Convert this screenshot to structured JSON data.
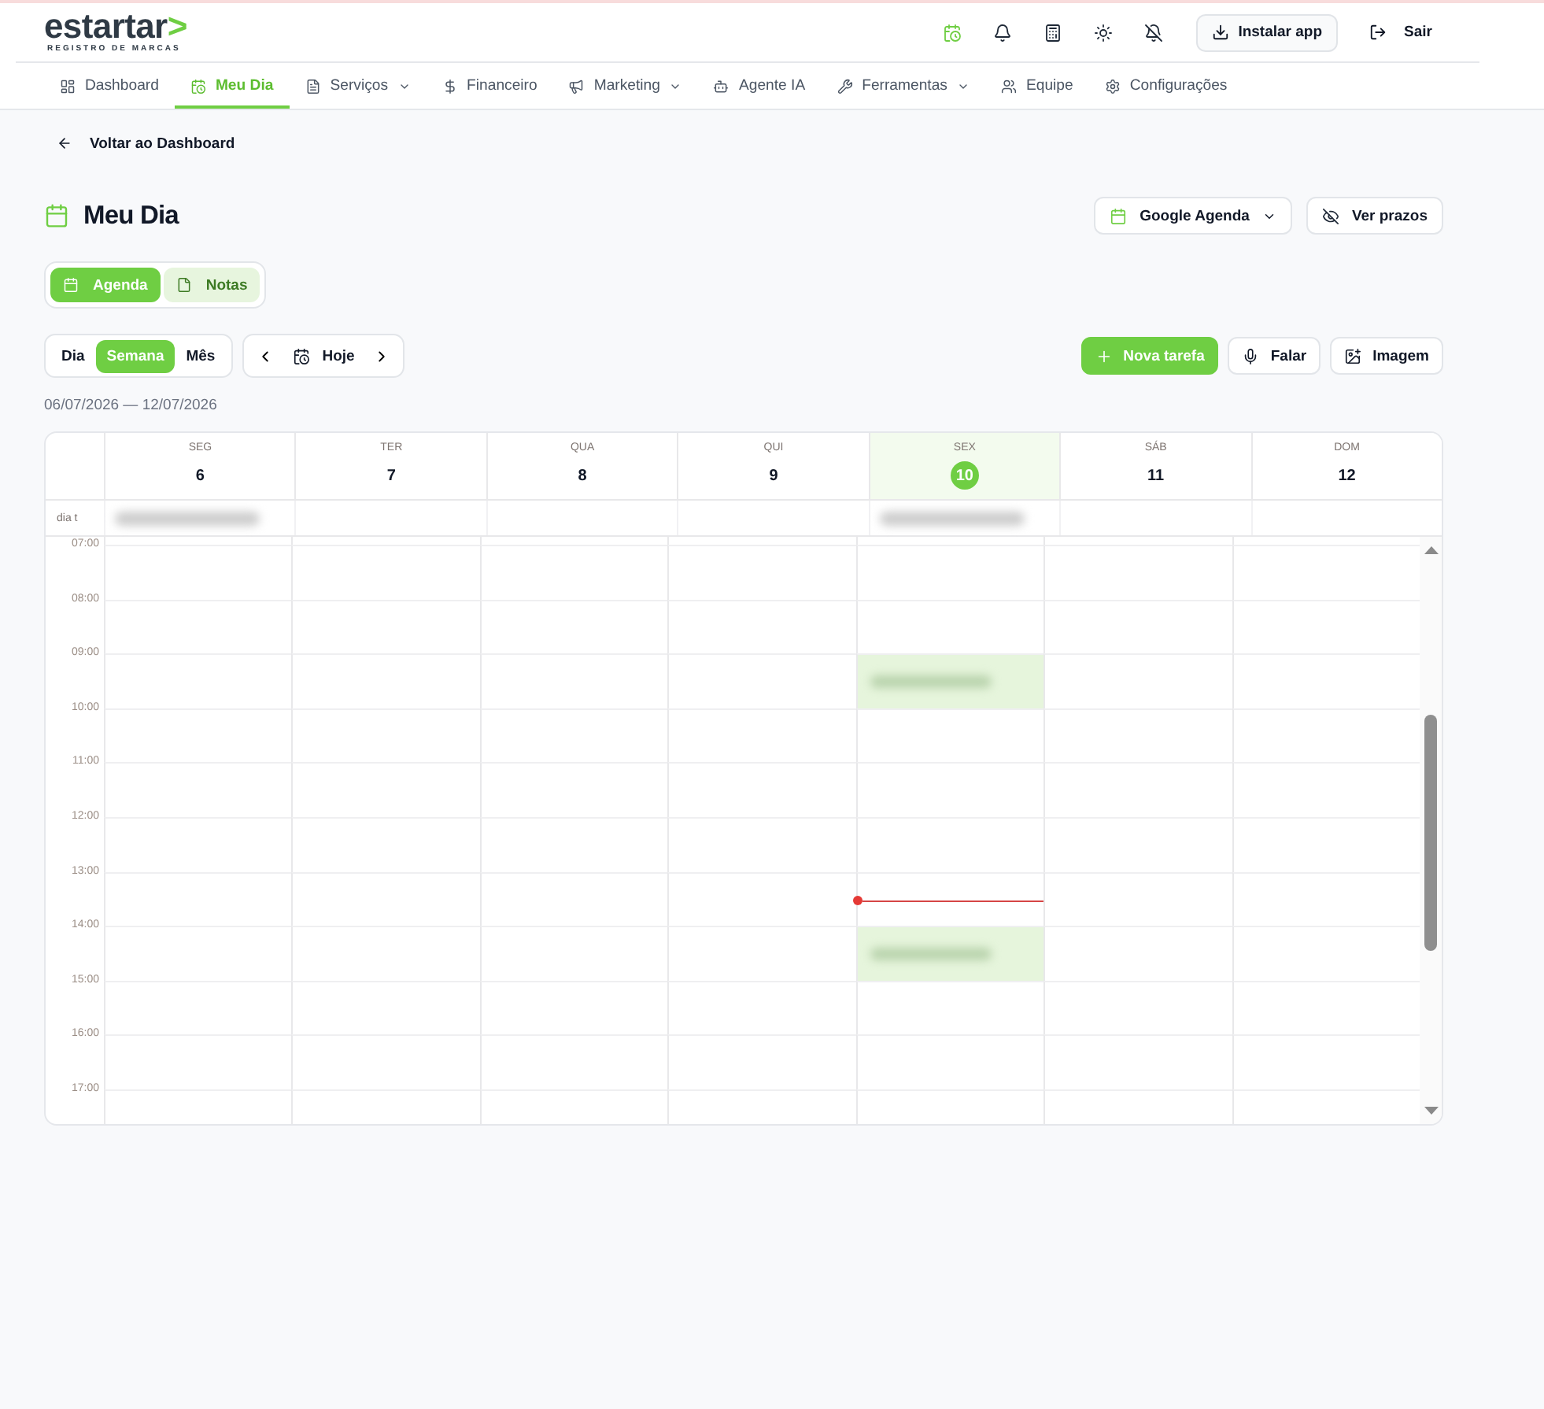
{
  "header": {
    "logo": {
      "name": "estartar",
      "mark": ">",
      "tagline": "REGISTRO DE MARCAS"
    },
    "icon_buttons": [
      {
        "kind": "calendar",
        "active": true
      },
      {
        "kind": "bell",
        "active": false
      },
      {
        "kind": "calculator",
        "active": false
      },
      {
        "kind": "theme",
        "active": false
      },
      {
        "kind": "mute",
        "active": false
      }
    ],
    "install_button": {
      "label": "Instalar app"
    },
    "logout_button": {
      "label": "Sair"
    }
  },
  "nav": [
    {
      "label": "Dashboard",
      "kind": "dashboard",
      "selected": false,
      "dropdown": false
    },
    {
      "label": "Meu Dia",
      "kind": "calendar",
      "selected": true,
      "dropdown": false
    },
    {
      "label": "Serviços",
      "kind": "document",
      "selected": false,
      "dropdown": true
    },
    {
      "label": "Financeiro",
      "kind": "money",
      "selected": false,
      "dropdown": false
    },
    {
      "label": "Marketing",
      "kind": "megaphone",
      "selected": false,
      "dropdown": true
    },
    {
      "label": "Agente IA",
      "kind": "bot",
      "selected": false,
      "dropdown": false
    },
    {
      "label": "Ferramentas",
      "kind": "tools",
      "selected": false,
      "dropdown": true
    },
    {
      "label": "Equipe",
      "kind": "team",
      "selected": false,
      "dropdown": false
    },
    {
      "label": "Configurações",
      "kind": "settings",
      "selected": false,
      "dropdown": false
    }
  ],
  "back_link": {
    "label": "Voltar ao Dashboard"
  },
  "page_title": "Meu Dia",
  "title_actions": [
    {
      "label": "Google Agenda",
      "kind": "calendar",
      "dropdown": true
    },
    {
      "label": "Ver prazos",
      "kind": "hidden",
      "dropdown": false
    }
  ],
  "view_tabs": [
    {
      "label": "Agenda",
      "kind": "calendar",
      "selected": true
    },
    {
      "label": "Notas",
      "kind": "file",
      "selected": false
    }
  ],
  "range_tabs": [
    {
      "label": "Dia",
      "selected": false
    },
    {
      "label": "Semana",
      "selected": true
    },
    {
      "label": "Mês",
      "selected": false
    }
  ],
  "today_button": {
    "label": "Hoje"
  },
  "actions": [
    {
      "label": "Nova tarefa",
      "kind": "add",
      "primary": true
    },
    {
      "label": "Falar",
      "kind": "voice",
      "primary": false
    },
    {
      "label": "Imagem",
      "kind": "image",
      "primary": false
    }
  ],
  "date_range": "06/07/2026 — 12/07/2026",
  "calendar": {
    "days": [
      {
        "weekday": "SEG",
        "date": "6",
        "today": false,
        "all_day_event": true
      },
      {
        "weekday": "TER",
        "date": "7",
        "today": false,
        "all_day_event": false
      },
      {
        "weekday": "QUA",
        "date": "8",
        "today": false,
        "all_day_event": false
      },
      {
        "weekday": "QUI",
        "date": "9",
        "today": false,
        "all_day_event": false
      },
      {
        "weekday": "SEX",
        "date": "10",
        "today": true,
        "all_day_event": true
      },
      {
        "weekday": "SÁB",
        "date": "11",
        "today": false,
        "all_day_event": false
      },
      {
        "weekday": "DOM",
        "date": "12",
        "today": false,
        "all_day_event": false
      }
    ],
    "all_day_label": "dia t",
    "hours": [
      {
        "label": "07:00",
        "now": false,
        "busy": [
          false,
          false,
          false,
          false,
          false,
          false,
          false
        ]
      },
      {
        "label": "08:00",
        "now": false,
        "busy": [
          false,
          false,
          false,
          false,
          false,
          false,
          false
        ]
      },
      {
        "label": "09:00",
        "now": false,
        "busy": [
          false,
          false,
          false,
          false,
          true,
          false,
          false
        ]
      },
      {
        "label": "10:00",
        "now": false,
        "busy": [
          false,
          false,
          false,
          false,
          false,
          false,
          false
        ]
      },
      {
        "label": "11:00",
        "now": false,
        "busy": [
          false,
          false,
          false,
          false,
          false,
          false,
          false
        ]
      },
      {
        "label": "12:00",
        "now": false,
        "busy": [
          false,
          false,
          false,
          false,
          false,
          false,
          false
        ]
      },
      {
        "label": "13:00",
        "now": true,
        "busy": [
          false,
          false,
          false,
          false,
          false,
          false,
          false
        ]
      },
      {
        "label": "14:00",
        "now": false,
        "busy": [
          false,
          false,
          false,
          false,
          true,
          false,
          false
        ]
      },
      {
        "label": "15:00",
        "now": false,
        "busy": [
          false,
          false,
          false,
          false,
          false,
          false,
          false
        ]
      },
      {
        "label": "16:00",
        "now": false,
        "busy": [
          false,
          false,
          false,
          false,
          false,
          false,
          false
        ]
      },
      {
        "label": "17:00",
        "now": false,
        "busy": [
          false,
          false,
          false,
          false,
          false,
          false,
          false
        ]
      }
    ]
  }
}
